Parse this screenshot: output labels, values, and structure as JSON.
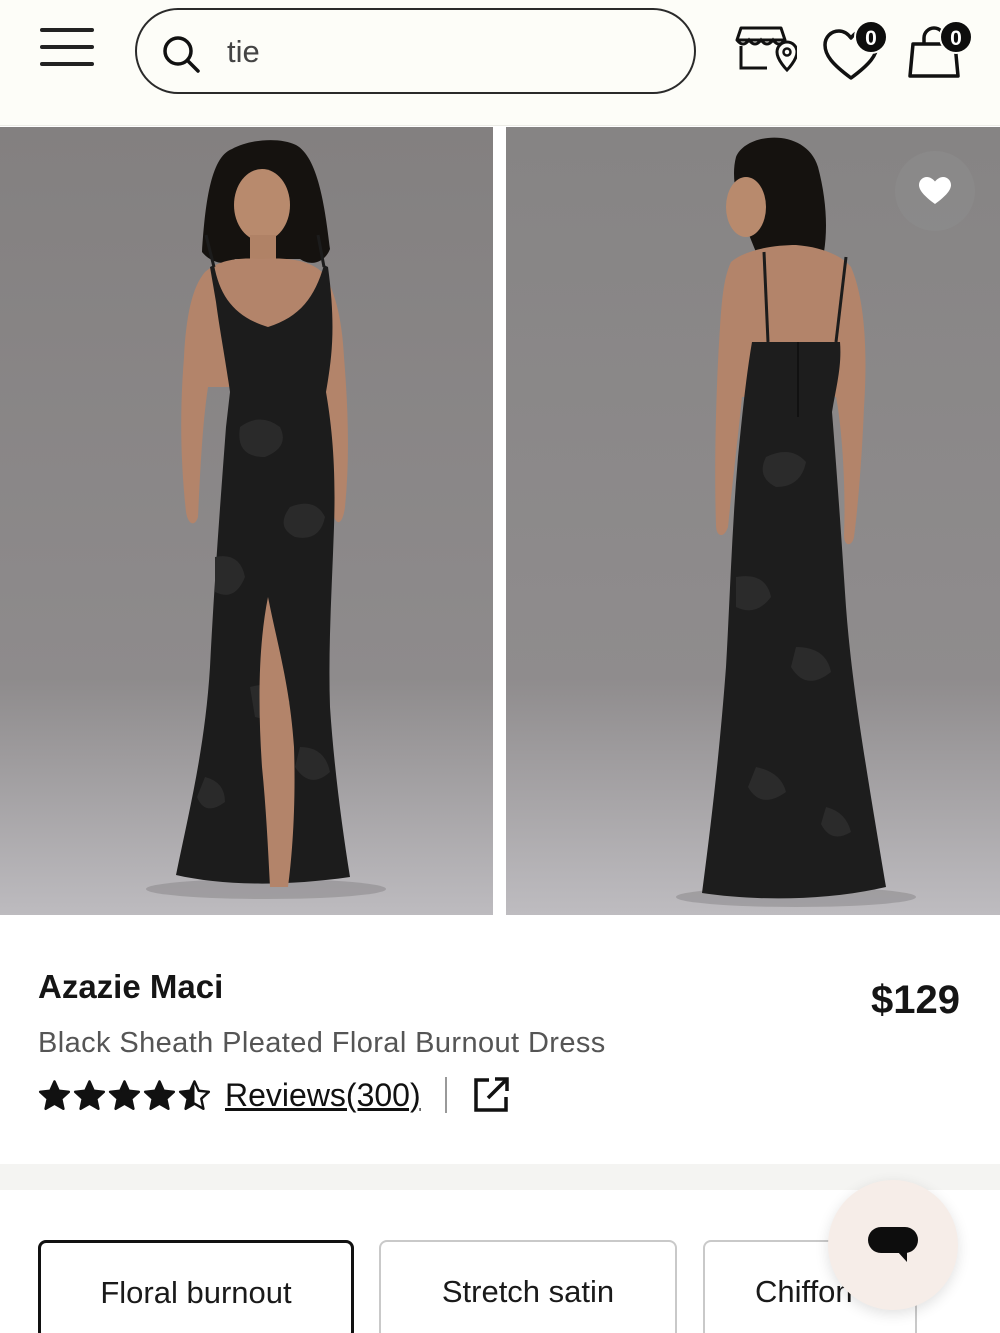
{
  "header": {
    "menu_icon": "hamburger-menu-icon",
    "search": {
      "value": "tie",
      "icon": "search-icon"
    },
    "store_icon": "store-locator-icon",
    "wishlist": {
      "icon": "heart-icon",
      "count": "0"
    },
    "cart": {
      "icon": "shopping-bag-icon",
      "count": "0"
    }
  },
  "gallery": {
    "images": [
      {
        "alt": "front-view"
      },
      {
        "alt": "back-view"
      }
    ],
    "favorite_icon": "heart-filled-icon"
  },
  "product": {
    "brand": "Azazie Maci",
    "name": "Black Sheath Pleated Floral Burnout Dress",
    "price": "$129",
    "rating": 4.5,
    "reviews_label": "Reviews(300)",
    "share_icon": "external-link-icon"
  },
  "fabrics": {
    "options": [
      "Floral burnout",
      "Stretch satin",
      "Chiffon"
    ],
    "selected": "Floral burnout"
  },
  "chat": {
    "icon": "chat-bubble-icon"
  },
  "colors": {
    "accent": "#111111",
    "chat_bg": "#f6ede8",
    "header_bg": "#fdfdf8"
  }
}
